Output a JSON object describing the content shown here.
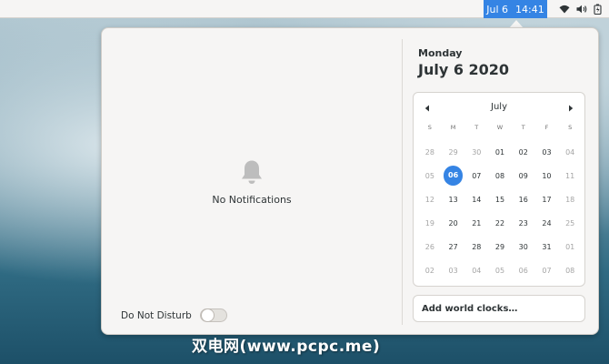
{
  "topbar": {
    "date_label": "Jul 6",
    "time_label": "14:41",
    "tray_icons": [
      "wifi-icon",
      "volume-icon",
      "battery-icon"
    ]
  },
  "notifications": {
    "empty_icon": "bell-icon",
    "empty_label": "No Notifications",
    "dnd_label": "Do Not Disturb",
    "dnd_enabled": false
  },
  "date": {
    "weekday": "Monday",
    "full": "July 6 2020"
  },
  "calendar": {
    "month": "July",
    "prev_icon": "arrow-left-icon",
    "next_icon": "arrow-right-icon",
    "weekdays": [
      "S",
      "M",
      "T",
      "W",
      "T",
      "F",
      "S"
    ],
    "weeks": [
      [
        {
          "d": "28",
          "dim": true
        },
        {
          "d": "29",
          "dim": true
        },
        {
          "d": "30",
          "dim": true
        },
        {
          "d": "01"
        },
        {
          "d": "02"
        },
        {
          "d": "03"
        },
        {
          "d": "04",
          "dim": true
        }
      ],
      [
        {
          "d": "05",
          "dim": true
        },
        {
          "d": "06",
          "today": true
        },
        {
          "d": "07"
        },
        {
          "d": "08"
        },
        {
          "d": "09"
        },
        {
          "d": "10"
        },
        {
          "d": "11",
          "dim": true
        }
      ],
      [
        {
          "d": "12",
          "dim": true
        },
        {
          "d": "13"
        },
        {
          "d": "14"
        },
        {
          "d": "15"
        },
        {
          "d": "16"
        },
        {
          "d": "17"
        },
        {
          "d": "18",
          "dim": true
        }
      ],
      [
        {
          "d": "19",
          "dim": true
        },
        {
          "d": "20"
        },
        {
          "d": "21"
        },
        {
          "d": "22"
        },
        {
          "d": "23"
        },
        {
          "d": "24"
        },
        {
          "d": "25",
          "dim": true
        }
      ],
      [
        {
          "d": "26",
          "dim": true
        },
        {
          "d": "27"
        },
        {
          "d": "28"
        },
        {
          "d": "29"
        },
        {
          "d": "30"
        },
        {
          "d": "31"
        },
        {
          "d": "01",
          "dim": true
        }
      ],
      [
        {
          "d": "02",
          "dim": true
        },
        {
          "d": "03",
          "dim": true
        },
        {
          "d": "04",
          "dim": true
        },
        {
          "d": "05",
          "dim": true
        },
        {
          "d": "06",
          "dim": true
        },
        {
          "d": "07",
          "dim": true
        },
        {
          "d": "08",
          "dim": true
        }
      ]
    ]
  },
  "world_clocks": {
    "label": "Add world clocks…"
  },
  "watermark": "双电网(www.pcpc.me)",
  "colors": {
    "accent": "#3584e4",
    "panel": "#f6f5f4",
    "text": "#2e3436"
  }
}
